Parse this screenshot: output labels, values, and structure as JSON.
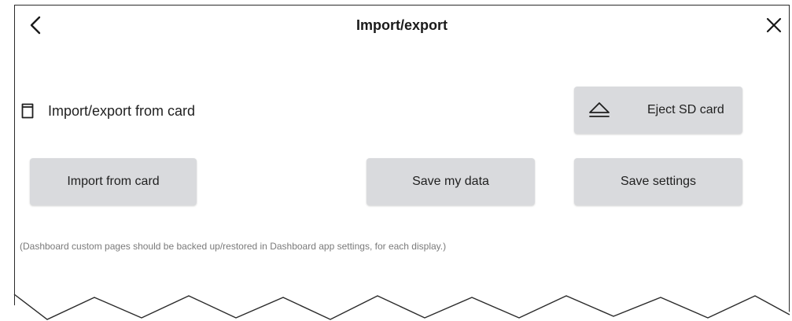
{
  "header": {
    "title": "Import/export",
    "back_icon": "chevron-left-icon",
    "close_icon": "close-icon"
  },
  "section": {
    "icon": "sd-card-icon",
    "label": "Import/export from card"
  },
  "buttons": {
    "eject_label": "Eject SD card",
    "eject_icon": "eject-icon",
    "import_label": "Import from card",
    "save_data_label": "Save my data",
    "save_settings_label": "Save settings"
  },
  "note": "(Dashboard custom pages should be backed up/restored in Dashboard app settings, for each display.)",
  "colors": {
    "button_bg": "#d9dadd",
    "note_text": "#7a7a7a",
    "title_text": "#1a1a1a"
  }
}
